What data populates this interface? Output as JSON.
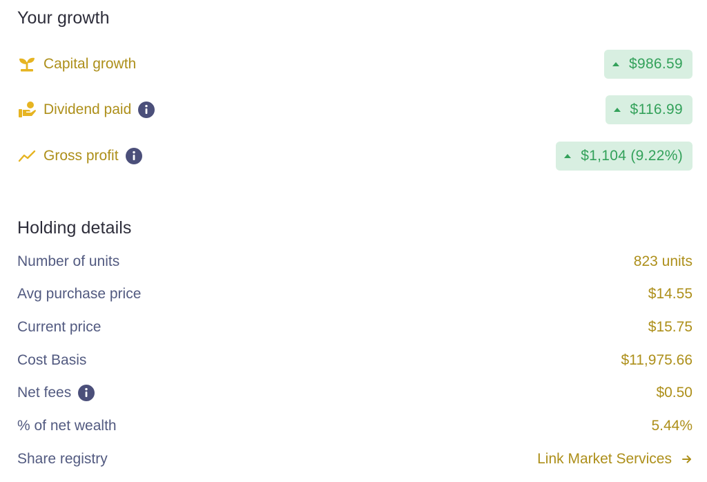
{
  "growth": {
    "title": "Your growth",
    "items": [
      {
        "icon": "sprout-icon",
        "label": "Capital growth",
        "value": "$986.59",
        "info": false
      },
      {
        "icon": "dividend-hand-icon",
        "label": "Dividend paid",
        "value": "$116.99",
        "info": true
      },
      {
        "icon": "trend-up-icon",
        "label": "Gross profit",
        "value": "$1,104 (9.22%)",
        "info": true
      }
    ]
  },
  "holding": {
    "title": "Holding details",
    "rows": [
      {
        "label": "Number of units",
        "value": "823 units",
        "info": false
      },
      {
        "label": "Avg purchase price",
        "value": "$14.55",
        "info": false
      },
      {
        "label": "Current price",
        "value": "$15.75",
        "info": false
      },
      {
        "label": "Cost Basis",
        "value": "$11,975.66",
        "info": false
      },
      {
        "label": "Net fees",
        "value": "$0.50",
        "info": true
      },
      {
        "label": "% of net wealth",
        "value": "5.44%",
        "info": false
      },
      {
        "label": "Share registry",
        "value": "Link Market Services",
        "info": false,
        "link": true
      }
    ]
  },
  "colors": {
    "accent_gold": "#ad8f1a",
    "positive_green": "#33a15a",
    "positive_bg": "#d8efe1",
    "label_slate": "#525a80",
    "info_icon": "#4b4f7a",
    "heading": "#2d2d3a"
  }
}
